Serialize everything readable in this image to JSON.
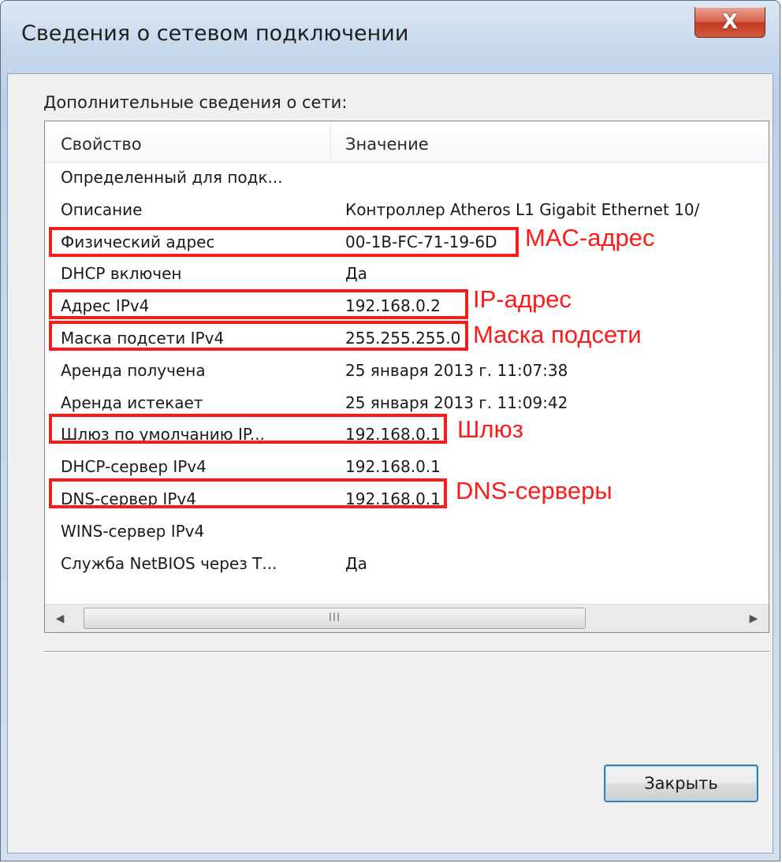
{
  "window": {
    "title": "Сведения о сетевом подключении",
    "close_glyph": "X"
  },
  "main": {
    "section_label": "Дополнительные сведения о сети:",
    "columns": {
      "property": "Свойство",
      "value": "Значение"
    },
    "rows": [
      {
        "property": "Определенный для подк...",
        "value": ""
      },
      {
        "property": "Описание",
        "value": "Контроллер Atheros L1 Gigabit Ethernet 10/"
      },
      {
        "property": "Физический адрес",
        "value": "00-1B-FC-71-19-6D"
      },
      {
        "property": "DHCP включен",
        "value": "Да"
      },
      {
        "property": "Адрес IPv4",
        "value": "192.168.0.2"
      },
      {
        "property": "Маска подсети IPv4",
        "value": "255.255.255.0"
      },
      {
        "property": "Аренда получена",
        "value": "25 января 2013 г. 11:07:38"
      },
      {
        "property": "Аренда истекает",
        "value": "25 января 2013 г. 11:09:42"
      },
      {
        "property": "Шлюз по умолчанию IP...",
        "value": "192.168.0.1"
      },
      {
        "property": "DHCP-сервер IPv4",
        "value": "192.168.0.1"
      },
      {
        "property": "DNS-сервер IPv4",
        "value": "192.168.0.1"
      },
      {
        "property": "WINS-сервер IPv4",
        "value": ""
      },
      {
        "property": "Служба NetBIOS через Т...",
        "value": "Да"
      }
    ],
    "scrollbar": {
      "left_arrow": "◀",
      "right_arrow": "▶",
      "grip": "III"
    }
  },
  "footer": {
    "close_button": "Закрыть"
  },
  "annotations": {
    "mac": "MAC-адрес",
    "ip": "IP-адрес",
    "mask": "Маска подсети",
    "gateway": "Шлюз",
    "dns": "DNS-серверы"
  },
  "colors": {
    "annotation": "#ff1a1a",
    "close_button_red": "#c23b22",
    "focus_border": "#3c7fb1"
  }
}
